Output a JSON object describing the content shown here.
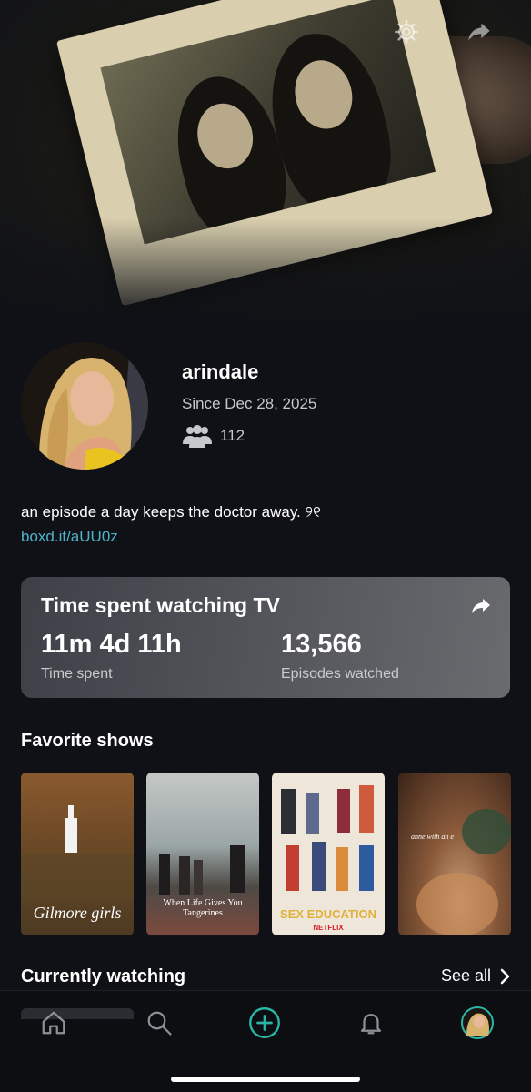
{
  "profile": {
    "username": "arindale",
    "since": "Since Dec 28, 2025",
    "followers": "112",
    "bio": "an episode a day keeps the doctor away. ୨୧",
    "link": "boxd.it/aUU0z"
  },
  "stats": {
    "title": "Time spent watching TV",
    "time_value": "11m 4d 11h",
    "time_label": "Time spent",
    "episodes_value": "13,566",
    "episodes_label": "Episodes watched"
  },
  "favorites": {
    "title": "Favorite shows",
    "shows": [
      {
        "caption": "Gilmore girls"
      },
      {
        "caption": "When Life Gives You Tangerines"
      },
      {
        "caption": "SEX EDUCATION",
        "badge": "NETFLIX"
      },
      {
        "caption": "anne with an e"
      }
    ]
  },
  "currently_watching": {
    "title": "Currently watching",
    "see_all": "See all"
  },
  "colors": {
    "background": "#0f1116",
    "accent": "#2ab5a5",
    "link": "#4fb3c8"
  },
  "icons": {
    "settings": "gear-icon",
    "share": "share-icon",
    "followers": "people-icon",
    "home": "home-icon",
    "search": "search-icon",
    "add": "plus-circle-icon",
    "notifications": "bell-icon",
    "profile": "avatar"
  }
}
